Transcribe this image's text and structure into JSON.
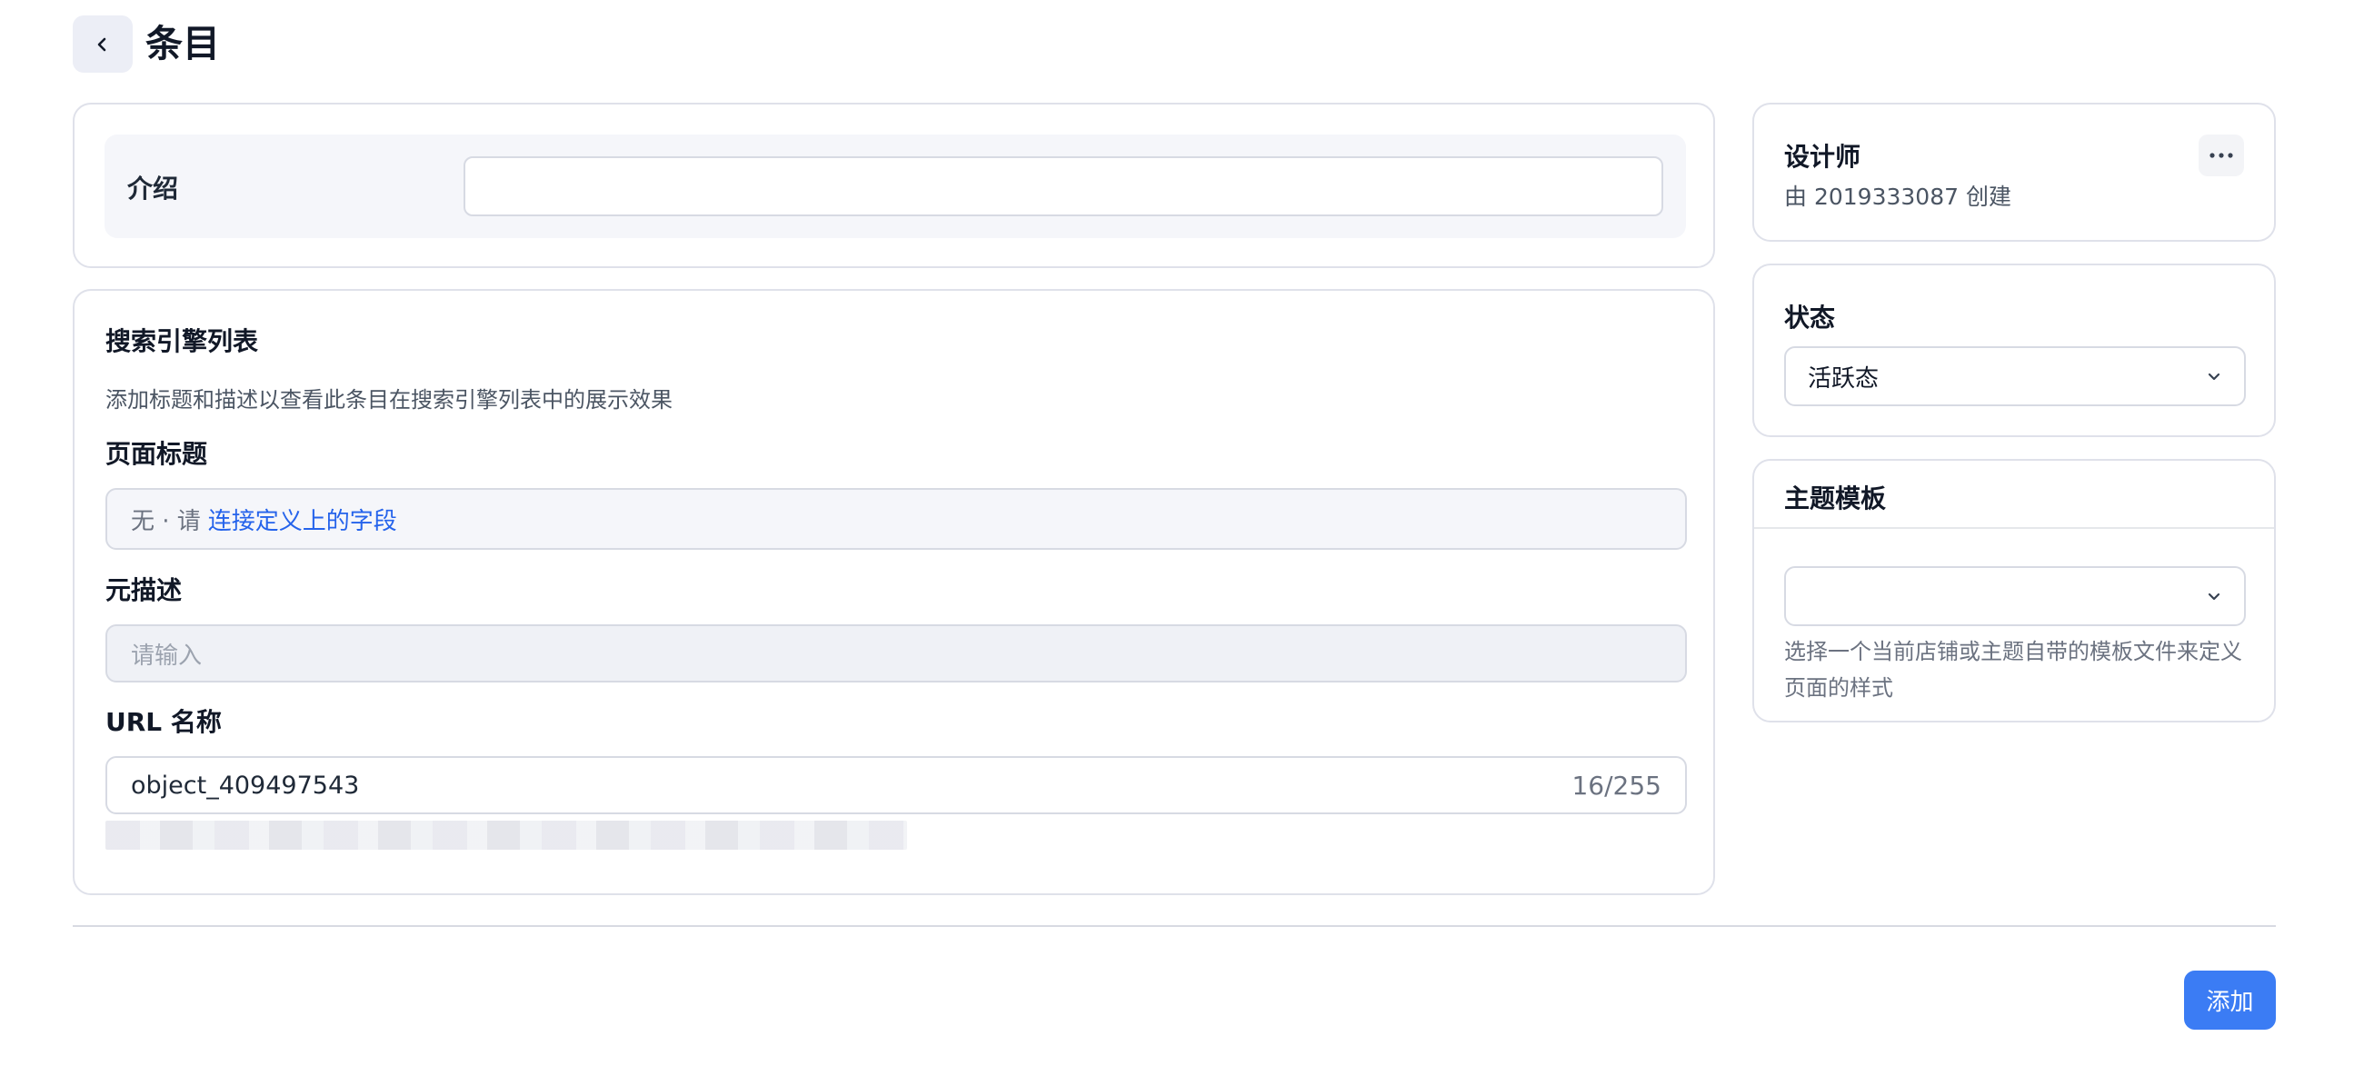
{
  "header": {
    "back_icon": "chevron-left-icon",
    "title": "条目"
  },
  "intro": {
    "label": "介绍",
    "value": ""
  },
  "seo": {
    "title": "搜索引擎列表",
    "description": "添加标题和描述以查看此条目在搜索引擎列表中的展示效果",
    "page_title": {
      "label": "页面标题",
      "prefix": "无 · 请",
      "link": "连接定义上的字段"
    },
    "meta_description": {
      "label": "元描述",
      "placeholder": "请输入"
    },
    "url_name": {
      "label": "URL 名称",
      "value": "object_409497543",
      "counter": "16/255"
    }
  },
  "designer": {
    "title": "设计师",
    "subtitle": "由 2019333087 创建",
    "more_icon": "more-horizontal-icon"
  },
  "status": {
    "title": "状态",
    "selected": "活跃态"
  },
  "theme_template": {
    "title": "主题模板",
    "selected": "",
    "help": "选择一个当前店铺或主题自带的模板文件来定义页面的样式"
  },
  "footer": {
    "add_label": "添加"
  },
  "colors": {
    "primary": "#3b7cf4",
    "link": "#2563eb",
    "border": "#dfe1ea"
  }
}
